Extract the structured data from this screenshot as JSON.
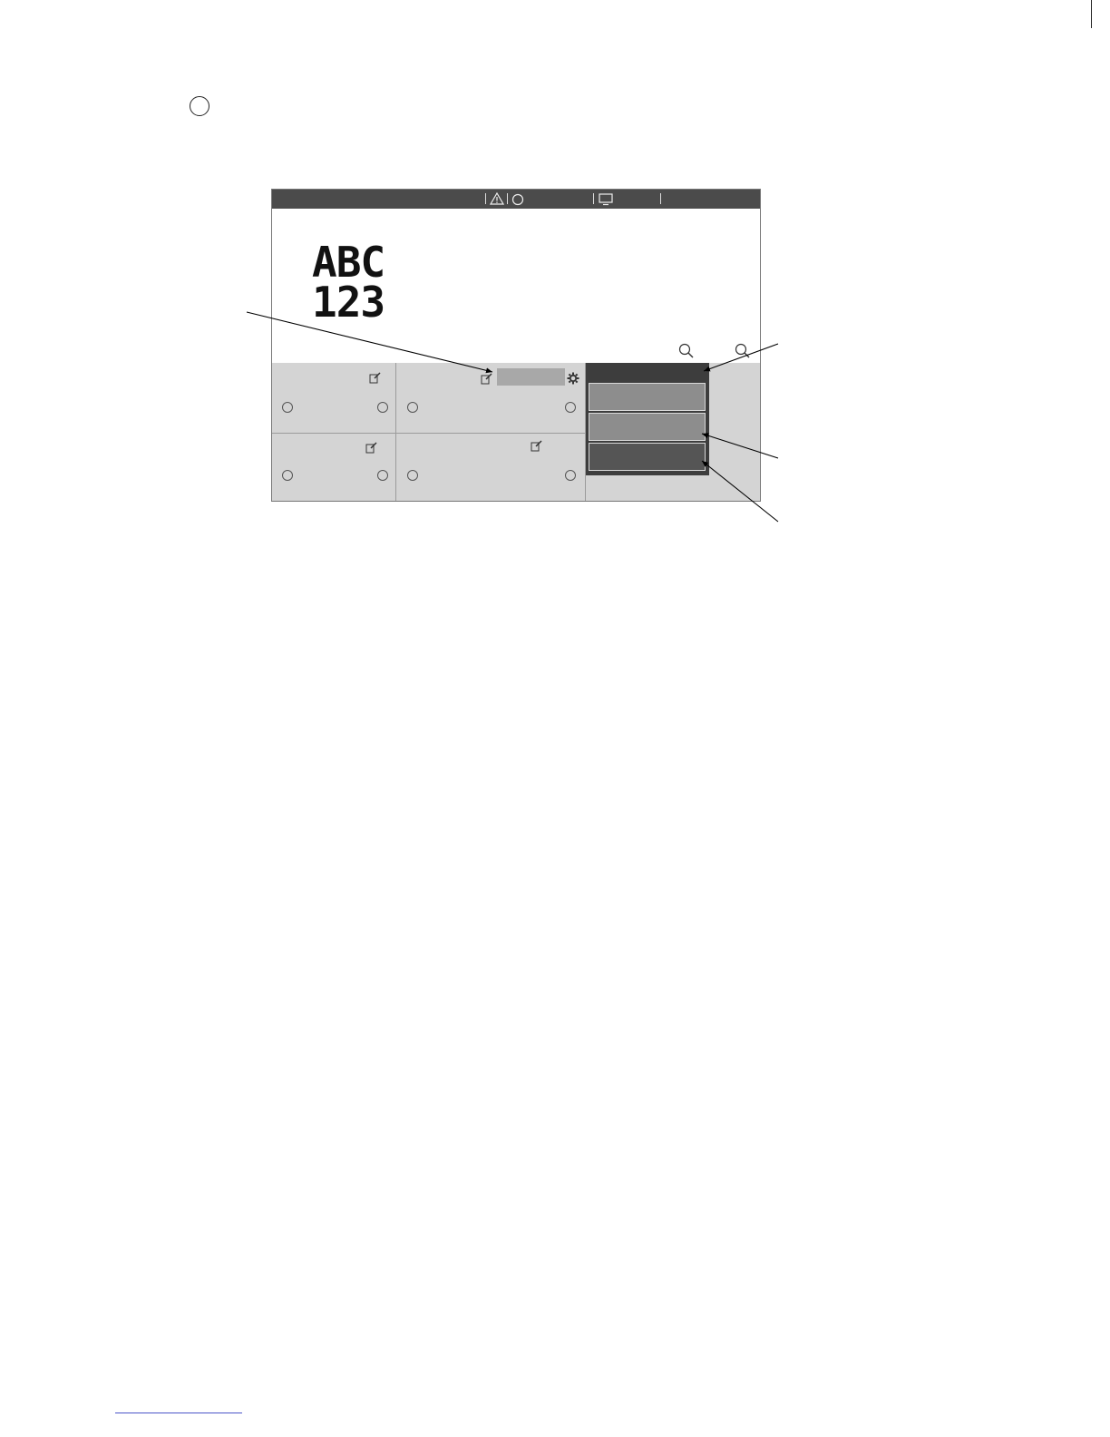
{
  "page": {
    "step_marker": "",
    "footer_link": ""
  },
  "screen": {
    "status_bar": {
      "icons": [
        "warning-icon",
        "circle-status-icon",
        "monitor-icon"
      ]
    },
    "preview": {
      "line1": "ABC",
      "line2": "123"
    },
    "zoom_icons": [
      "zoom-in-icon",
      "zoom-out-icon"
    ],
    "cells": [
      {
        "name": "cell-top-left",
        "icon": "edit-icon"
      },
      {
        "name": "cell-top-middle",
        "icon": "edit-icon",
        "extra": [
          "text-field",
          "gear-icon"
        ]
      },
      {
        "name": "cell-bottom-left",
        "icon": "edit-icon"
      },
      {
        "name": "cell-bottom-middle",
        "icon": "edit-icon"
      }
    ],
    "dropdown": {
      "options": [
        "option-1",
        "option-2",
        "option-3"
      ]
    }
  },
  "callouts": [
    "callout-edit-field",
    "callout-dropdown-header",
    "callout-option-2",
    "callout-option-3"
  ],
  "colors": {
    "status_bar": "#4b4b4b",
    "panel": "#d4d4d4",
    "dropdown": "#3d3d3d",
    "option_light": "#8d8d8d",
    "option_dark": "#555555",
    "footer_rule": "#4a55c8"
  }
}
